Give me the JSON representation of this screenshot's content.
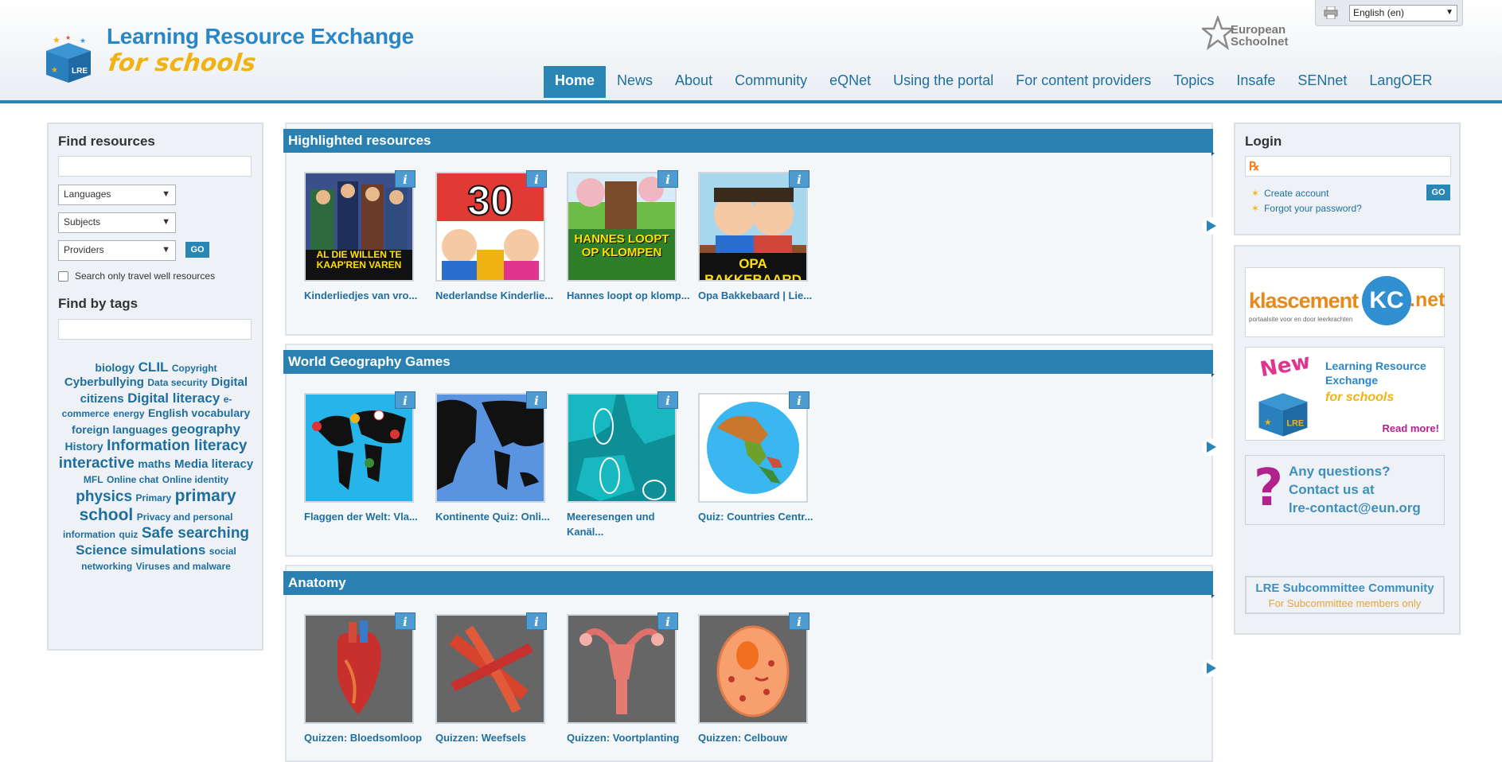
{
  "header": {
    "logo_title": "Learning Resource Exchange",
    "logo_sub": "for schools",
    "logo_box_text": "LRE",
    "eun_line1": "European",
    "eun_line2": "Schoolnet",
    "language": "English (en)"
  },
  "nav": [
    {
      "label": "Home",
      "active": true
    },
    {
      "label": "News"
    },
    {
      "label": "About"
    },
    {
      "label": "Community"
    },
    {
      "label": "eQNet"
    },
    {
      "label": "Using the portal"
    },
    {
      "label": "For content providers"
    },
    {
      "label": "Topics"
    },
    {
      "label": "Insafe"
    },
    {
      "label": "SENnet"
    },
    {
      "label": "LangOER"
    }
  ],
  "find": {
    "title": "Find resources",
    "languages": "Languages",
    "subjects": "Subjects",
    "providers": "Providers",
    "go": "GO",
    "travel_well": "Search only travel well resources",
    "tags_title": "Find by tags"
  },
  "tags": [
    {
      "label": "biology",
      "size": "t2"
    },
    {
      "label": "CLIL",
      "size": "t4"
    },
    {
      "label": "Copyright",
      "size": "t1"
    },
    {
      "label": "Cyberbullying",
      "size": "t3"
    },
    {
      "label": "Data security",
      "size": "t1"
    },
    {
      "label": "Digital citizens",
      "size": "t3"
    },
    {
      "label": "Digital literacy",
      "size": "t4"
    },
    {
      "label": "e-commerce",
      "size": "t1"
    },
    {
      "label": "energy",
      "size": "t1"
    },
    {
      "label": "English vocabulary",
      "size": "t2"
    },
    {
      "label": "foreign languages",
      "size": "t2"
    },
    {
      "label": "geography",
      "size": "t4"
    },
    {
      "label": "History",
      "size": "t2"
    },
    {
      "label": "Information literacy",
      "size": "t5"
    },
    {
      "label": "interactive",
      "size": "t5"
    },
    {
      "label": "maths",
      "size": "t2"
    },
    {
      "label": "Media literacy",
      "size": "t3"
    },
    {
      "label": "MFL",
      "size": "t1"
    },
    {
      "label": "Online chat",
      "size": "t1"
    },
    {
      "label": "Online identity",
      "size": "t1"
    },
    {
      "label": "physics",
      "size": "t5"
    },
    {
      "label": "Primary",
      "size": "t1"
    },
    {
      "label": "primary school",
      "size": "t6"
    },
    {
      "label": "Privacy and personal information",
      "size": "t1"
    },
    {
      "label": "quiz",
      "size": "t1"
    },
    {
      "label": "Safe searching",
      "size": "t5"
    },
    {
      "label": "Science",
      "size": "t4"
    },
    {
      "label": "simulations",
      "size": "t4"
    },
    {
      "label": "social networking",
      "size": "t1"
    },
    {
      "label": "Viruses and malware",
      "size": "t1"
    }
  ],
  "sections": [
    {
      "title": "Highlighted resources",
      "items": [
        {
          "caption": "Kinderliedjes van vro...",
          "thumb_text": "AL DIE WILLEN TE KAAP'REN VAREN",
          "theme": "song1"
        },
        {
          "caption": "Nederlandse Kinderlie...",
          "thumb_text": "30",
          "theme": "song2"
        },
        {
          "caption": "Hannes loopt op klomp...",
          "thumb_text": "HANNES LOOPT OP KLOMPEN",
          "theme": "song3"
        },
        {
          "caption": "Opa Bakkebaard | Lie...",
          "thumb_text": "OPA BAKKEBAARD",
          "theme": "song4"
        }
      ]
    },
    {
      "title": "World Geography Games",
      "items": [
        {
          "caption": "Flaggen der Welt: Vla...",
          "thumb_text": "",
          "theme": "geo1"
        },
        {
          "caption": "Kontinente Quiz: Onli...",
          "thumb_text": "",
          "theme": "geo2"
        },
        {
          "caption": "Meeresengen und Kanäl...",
          "thumb_text": "",
          "theme": "geo3"
        },
        {
          "caption": "Quiz: Countries Centr...",
          "thumb_text": "",
          "theme": "geo4"
        }
      ]
    },
    {
      "title": "Anatomy",
      "items": [
        {
          "caption": "Quizzen: Bloedsomloop",
          "thumb_text": "",
          "theme": "ana1"
        },
        {
          "caption": "Quizzen: Weefsels",
          "thumb_text": "",
          "theme": "ana2"
        },
        {
          "caption": "Quizzen: Voortplanting",
          "thumb_text": "",
          "theme": "ana3"
        },
        {
          "caption": "Quizzen: Celbouw",
          "thumb_text": "",
          "theme": "ana4"
        }
      ]
    }
  ],
  "login": {
    "title": "Login",
    "go": "GO",
    "create": "Create account",
    "forgot": "Forgot your password?"
  },
  "banners": {
    "klascement_main": "klascement",
    "klascement_badge": "KC",
    "klascement_suffix": ".net",
    "klascement_tagline": "portaalsite voor en door leerkrachten",
    "lre_new": "New",
    "lre_title": "Learning Resource Exchange",
    "lre_sub": "for schools",
    "lre_read": "Read more!",
    "question_mark": "?",
    "question_line1": "Any questions?",
    "question_line2": "Contact us at",
    "question_line3": "lre-contact@eun.org",
    "subcommittee_title": "LRE Subcommittee Community",
    "subcommittee_note": "For Subcommittee members only"
  },
  "colors": {
    "brand_blue": "#2a86b4",
    "link_blue": "#1e6f9f",
    "brand_yellow": "#f1b313",
    "question_purple": "#b3218d"
  }
}
